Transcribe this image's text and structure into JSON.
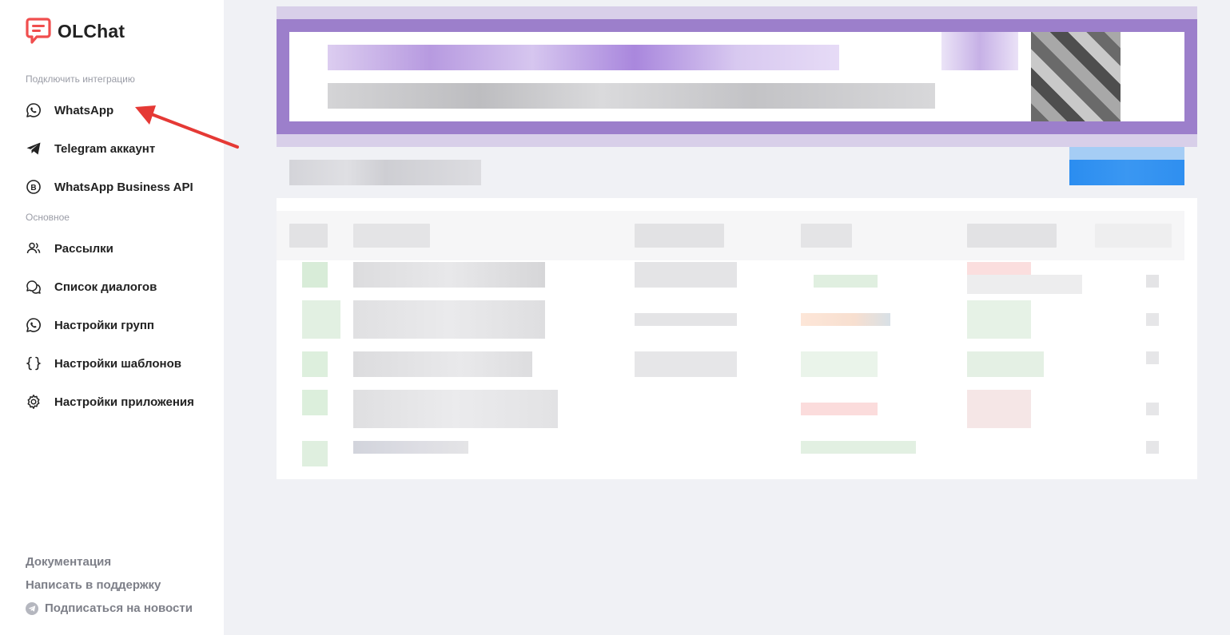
{
  "app": {
    "name": "OLChat"
  },
  "sections": {
    "integrations": "Подключить интеграцию",
    "main": "Основное"
  },
  "nav": {
    "whatsapp": "WhatsApp",
    "telegram": "Telegram аккаунт",
    "wa_business": "WhatsApp Business API",
    "mailings": "Рассылки",
    "dialogs": "Список диалогов",
    "groups": "Настройки групп",
    "templates": "Настройки шаблонов",
    "app_settings": "Настройки приложения"
  },
  "footer": {
    "docs": "Документация",
    "support": "Написать в поддержку",
    "news": "Подписаться на новости"
  },
  "colors": {
    "brand_red": "#f04e4e",
    "banner_purple": "#9c7fcb",
    "primary_blue": "#2b8df0",
    "annotation_arrow": "#e53935"
  }
}
